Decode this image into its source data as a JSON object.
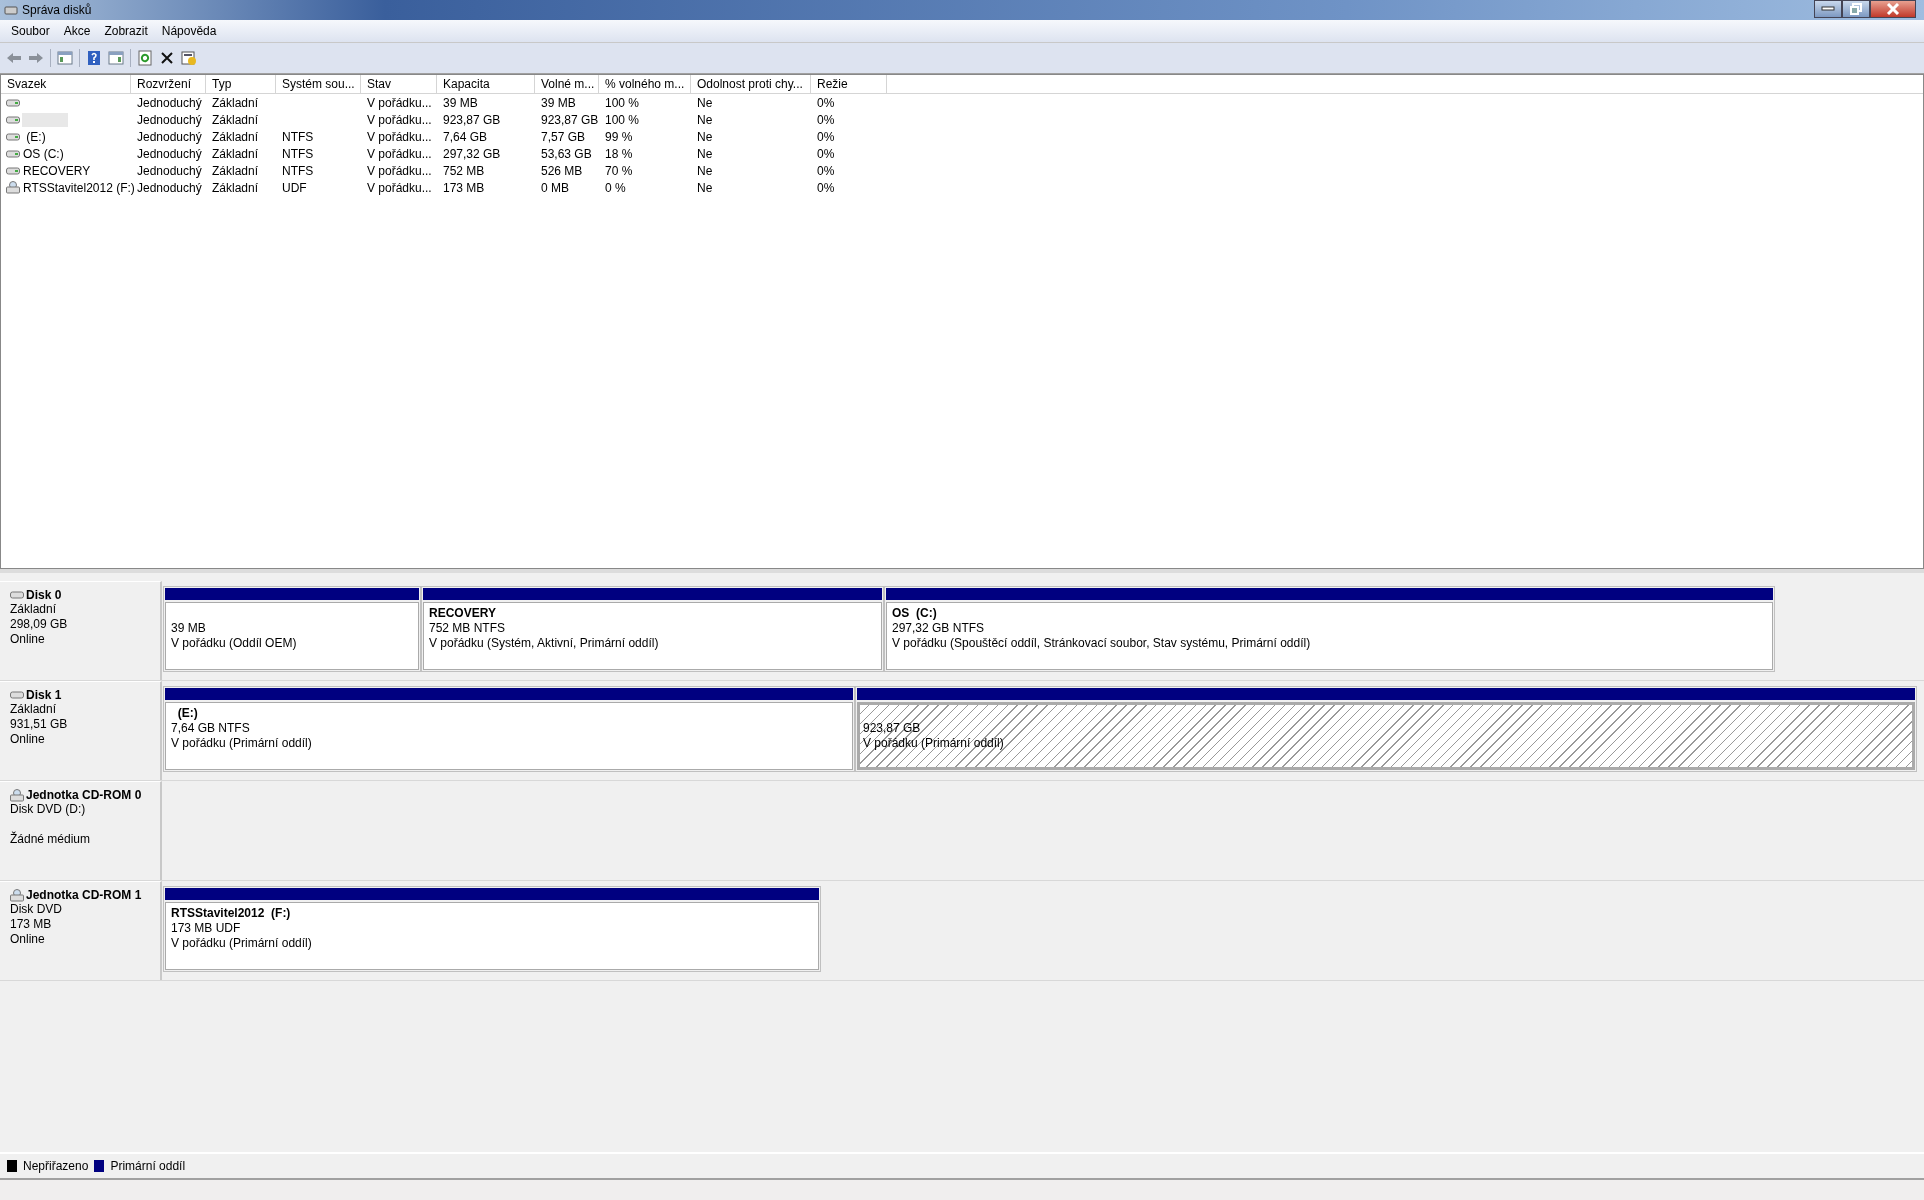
{
  "window": {
    "title": "Správa disků"
  },
  "menu": [
    "Soubor",
    "Akce",
    "Zobrazit",
    "Nápověda"
  ],
  "table": {
    "columns": [
      "Svazek",
      "Rozvržení",
      "Typ",
      "Systém sou...",
      "Stav",
      "Kapacita",
      "Volné m...",
      "% volného m...",
      "Odolnost proti chy...",
      "Režie"
    ],
    "rows": [
      {
        "kind": "disk",
        "selected": false,
        "cells": [
          "",
          "Jednoduchý",
          "Základní",
          "",
          "V pořádku...",
          "39 MB",
          "39 MB",
          "100 %",
          "Ne",
          "0%"
        ]
      },
      {
        "kind": "disk",
        "selected": true,
        "cells": [
          "",
          "Jednoduchý",
          "Základní",
          "",
          "V pořádku...",
          "923,87 GB",
          "923,87 GB",
          "100 %",
          "Ne",
          "0%"
        ]
      },
      {
        "kind": "disk",
        "selected": false,
        "cells": [
          " (E:)",
          "Jednoduchý",
          "Základní",
          "NTFS",
          "V pořádku...",
          "7,64 GB",
          "7,57 GB",
          "99 %",
          "Ne",
          "0%"
        ]
      },
      {
        "kind": "disk",
        "selected": false,
        "cells": [
          "OS (C:)",
          "Jednoduchý",
          "Základní",
          "NTFS",
          "V pořádku...",
          "297,32 GB",
          "53,63 GB",
          "18 %",
          "Ne",
          "0%"
        ]
      },
      {
        "kind": "disk",
        "selected": false,
        "cells": [
          "RECOVERY",
          "Jednoduchý",
          "Základní",
          "NTFS",
          "V pořádku...",
          "752 MB",
          "526 MB",
          "70 %",
          "Ne",
          "0%"
        ]
      },
      {
        "kind": "cd",
        "selected": false,
        "cells": [
          "RTSStavitel2012 (F:)",
          "Jednoduchý",
          "Základní",
          "UDF",
          "V pořádku...",
          "173 MB",
          "0 MB",
          "0 %",
          "Ne",
          "0%"
        ]
      }
    ]
  },
  "disks": [
    {
      "kind": "disk",
      "name": "Disk 0",
      "lines": [
        "Základní",
        "298,09 GB",
        "Online"
      ],
      "partitions": [
        {
          "size": "39 MB",
          "status": "V pořádku (Oddíl OEM)",
          "selected": false
        },
        {
          "name": "RECOVERY",
          "size": "752 MB NTFS",
          "status": "V pořádku (Systém, Aktivní, Primární oddíl)",
          "selected": false
        },
        {
          "name": "OS  (C:)",
          "size": "297,32 GB NTFS",
          "status": "V pořádku (Spouštěcí oddíl, Stránkovací soubor, Stav systému, Primární oddíl)",
          "selected": false
        }
      ]
    },
    {
      "kind": "disk",
      "name": "Disk 1",
      "lines": [
        "Základní",
        "931,51 GB",
        "Online"
      ],
      "partitions": [
        {
          "name": "  (E:)",
          "size": "7,64 GB NTFS",
          "status": "V pořádku (Primární oddíl)",
          "selected": false
        },
        {
          "size": "923,87 GB",
          "status": "V pořádku (Primární oddíl)",
          "selected": true
        }
      ]
    },
    {
      "kind": "cd",
      "name": "Jednotka CD-ROM 0",
      "lines": [
        "Disk DVD (D:)",
        "Žádné médium"
      ]
    },
    {
      "kind": "cd",
      "name": "Jednotka CD-ROM 1",
      "lines": [
        "Disk DVD",
        "173 MB",
        "Online"
      ],
      "partitions": [
        {
          "name": "RTSStavitel2012  (F:)",
          "size": "173 MB UDF",
          "status": "V pořádku (Primární oddíl)",
          "selected": false
        }
      ]
    }
  ],
  "legend": [
    {
      "label": "Nepřiřazeno",
      "color": "#000000"
    },
    {
      "label": "Primární oddíl",
      "color": "#000080"
    }
  ]
}
